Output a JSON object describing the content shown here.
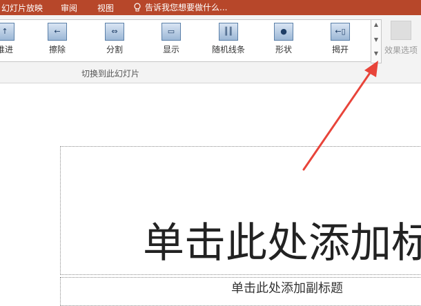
{
  "tabs": [
    "幻灯片放映",
    "审阅",
    "视图"
  ],
  "tell_me": "告诉我您想要做什么...",
  "gallery_items": [
    {
      "label": "推进",
      "icon": "push-icon"
    },
    {
      "label": "擦除",
      "icon": "wipe-icon"
    },
    {
      "label": "分割",
      "icon": "split-icon"
    },
    {
      "label": "显示",
      "icon": "reveal-icon"
    },
    {
      "label": "随机线条",
      "icon": "random-bars-icon"
    },
    {
      "label": "形状",
      "icon": "shape-icon"
    },
    {
      "label": "揭开",
      "icon": "uncover-icon"
    }
  ],
  "effect_options": "效果选项",
  "group_label": "切换到此幻灯片",
  "slide": {
    "title_placeholder": "单击此处添加标",
    "subtitle_placeholder": "单击此处添加副标题"
  },
  "colors": {
    "accent": "#b7472a",
    "annotation_arrow": "#e8443a"
  }
}
